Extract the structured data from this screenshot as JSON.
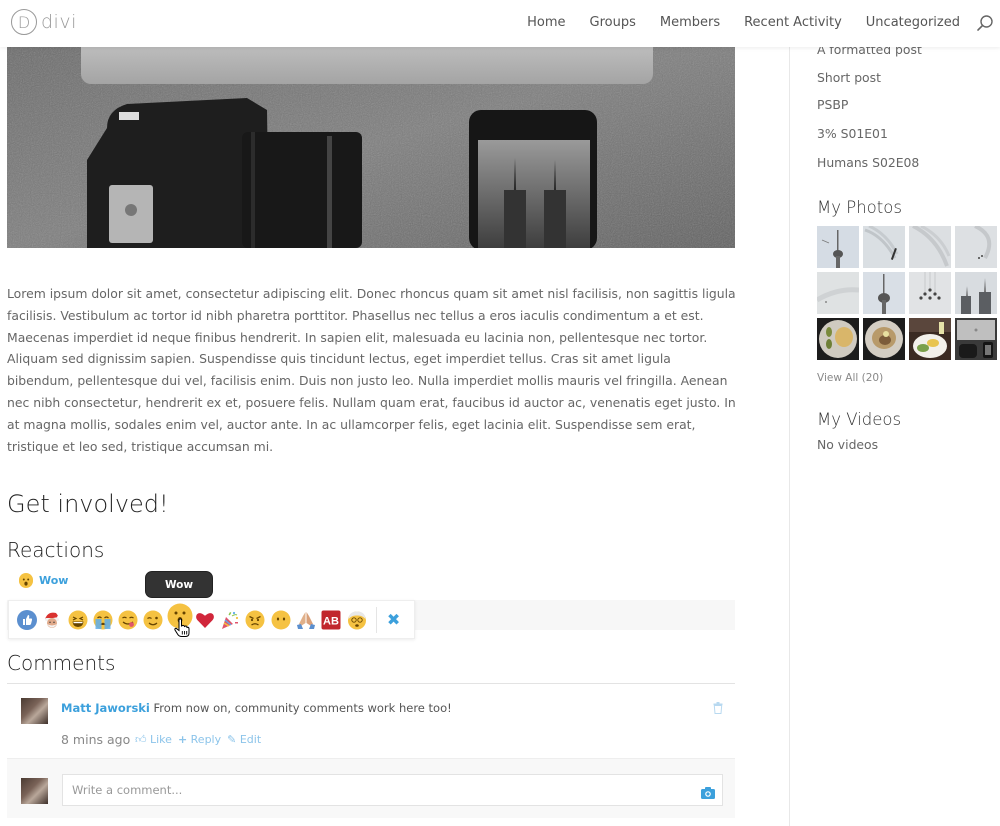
{
  "site": {
    "logo_letter": "D",
    "logo_text": "divi"
  },
  "nav": {
    "items": [
      "Home",
      "Groups",
      "Members",
      "Recent Activity",
      "Uncategorized"
    ],
    "search_icon": "search-icon"
  },
  "post": {
    "hero_image_alt": "Camera, phone and laptop on grey fabric",
    "body": "Lorem ipsum dolor sit amet, consectetur adipiscing elit. Donec rhoncus quam sit amet nisl facilisis, non sagittis ligula facilisis. Vestibulum ac tortor id nibh pharetra porttitor. Phasellus nec tellus a eros iaculis condimentum a et est. Maecenas imperdiet id neque finibus hendrerit. In sapien elit, malesuada eu lacinia non, pellentesque nec tortor. Aliquam sed dignissim sapien. Suspendisse quis tincidunt lectus, eget imperdiet tellus. Cras sit amet ligula bibendum, pellentesque dui vel, facilisis enim. Duis non justo leo. Nulla imperdiet mollis mauris vel fringilla. Aenean nec nibh consectetur, hendrerit ex et, posuere felis. Nullam quam erat, faucibus id auctor ac, venenatis eget justo. In at magna mollis, sodales enim vel, auctor ante. In ac ullamcorper felis, eget lacinia elit. Suspendisse sem erat, tristique et leo sed, tristique accumsan mi."
  },
  "involved": {
    "title": "Get involved!",
    "reactions_title": "Reactions",
    "current_reaction": "Wow",
    "tooltip": "Wow",
    "picker": [
      {
        "name": "like",
        "icon": "thumbs-up-icon"
      },
      {
        "name": "santa",
        "icon": "santa-icon"
      },
      {
        "name": "laugh",
        "icon": "laughing-face-icon"
      },
      {
        "name": "cry",
        "icon": "crying-face-icon"
      },
      {
        "name": "yum",
        "icon": "yum-face-icon"
      },
      {
        "name": "wink",
        "icon": "wink-face-icon"
      },
      {
        "name": "wow",
        "icon": "wow-face-icon"
      },
      {
        "name": "love",
        "icon": "heart-icon"
      },
      {
        "name": "party",
        "icon": "party-popper-icon"
      },
      {
        "name": "angry",
        "icon": "angry-face-icon"
      },
      {
        "name": "speechless",
        "icon": "no-mouth-face-icon"
      },
      {
        "name": "pray",
        "icon": "praying-hands-icon"
      },
      {
        "name": "ab",
        "icon": "ab-button-icon",
        "label": "AB"
      },
      {
        "name": "old",
        "icon": "older-face-icon"
      }
    ],
    "close_label": "✖"
  },
  "comments": {
    "title": "Comments",
    "items": [
      {
        "author": "Matt Jaworski",
        "text": "From now on, community comments work here too!",
        "time": "8 mins ago",
        "actions": {
          "like": "Like",
          "reply": "Reply",
          "edit": "Edit"
        }
      }
    ],
    "write_placeholder": "Write a comment..."
  },
  "sidebar": {
    "recent_posts": [
      "A formatted post",
      "Short post",
      "PSBP",
      "3% S01E01",
      "Humans S02E08"
    ],
    "photos_title": "My Photos",
    "photos_count": 12,
    "view_all": "View All (20)",
    "videos_title": "My Videos",
    "videos_empty": "No videos"
  },
  "colors": {
    "accent": "#3ca0dc",
    "accent_light": "#8cc4ea",
    "tooltip_bg": "#333333"
  }
}
